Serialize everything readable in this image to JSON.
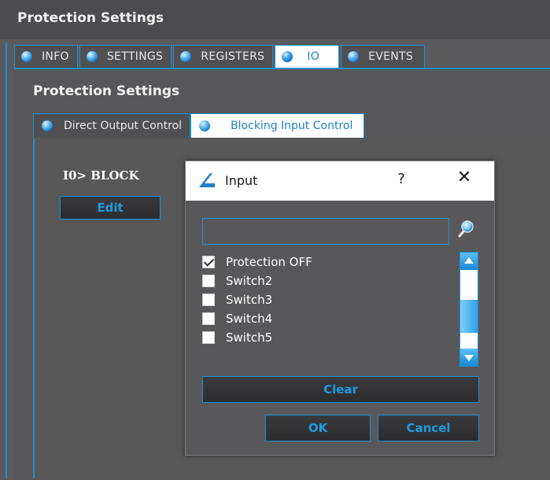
{
  "header": {
    "title": "Protection Settings"
  },
  "main_tabs": [
    {
      "label": "INFO",
      "active": false
    },
    {
      "label": "SETTINGS",
      "active": false
    },
    {
      "label": "REGISTERS",
      "active": false
    },
    {
      "label": "IO",
      "active": true
    },
    {
      "label": "EVENTS",
      "active": false
    }
  ],
  "panel": {
    "title": "Protection Settings"
  },
  "sub_tabs": [
    {
      "label": "Direct Output Control",
      "active": false
    },
    {
      "label": "Blocking Input Control",
      "active": true
    }
  ],
  "block": {
    "label": "I0> BLOCK",
    "edit_label": "Edit"
  },
  "dialog": {
    "title": "Input",
    "help": "?",
    "close": "✕",
    "search": {
      "value": "",
      "placeholder": ""
    },
    "items": [
      {
        "label": "Protection OFF",
        "checked": true
      },
      {
        "label": "Switch2",
        "checked": false
      },
      {
        "label": "Switch3",
        "checked": false
      },
      {
        "label": "Switch4",
        "checked": false
      },
      {
        "label": "Switch5",
        "checked": false
      }
    ],
    "clear_label": "Clear",
    "ok_label": "OK",
    "cancel_label": "Cancel"
  },
  "colors": {
    "accent": "#1d8fd6",
    "background": "#5a5a5c",
    "button_text": "#1d9be0"
  }
}
